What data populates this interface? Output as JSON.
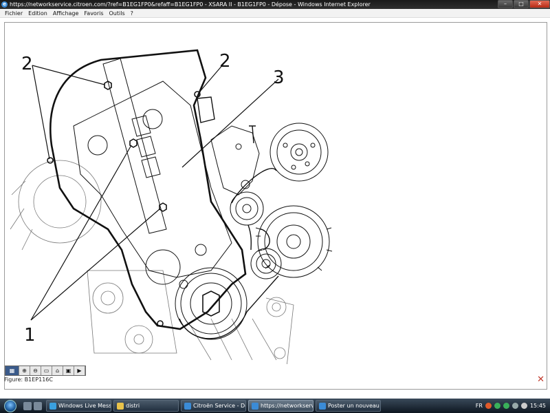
{
  "window": {
    "title": "https://networkservice.citroen.com/?ref=B1EG1FP0&refaff=B1EG1FP0 - XSARA II - B1EG1FP0 - Dépose - Windows Internet Explorer",
    "min": "–",
    "max": "□",
    "close": "✕"
  },
  "menu": [
    "Fichier",
    "Edition",
    "Affichage",
    "Favoris",
    "Outils",
    "?"
  ],
  "figure": {
    "labels": [
      "2",
      "2",
      "3",
      "1"
    ],
    "caption": "Figure: B1EP116C"
  },
  "viewer_toolbar": [
    "▦",
    "⊕",
    "⊖",
    "▭",
    "⌂",
    "▣",
    "▶"
  ],
  "close_glyph": "✕",
  "taskbar": {
    "items": [
      {
        "label": "Windows Live Mess...",
        "icon_color": "#3aa0e0"
      },
      {
        "label": "distri",
        "icon_color": "#e8c24a"
      },
      {
        "label": "Citroën Service - Do...",
        "icon_color": "#3b8bd6"
      },
      {
        "label": "https://networkservi...",
        "icon_color": "#3b8bd6"
      },
      {
        "label": "Poster un nouveau s...",
        "icon_color": "#3b8bd6"
      }
    ],
    "lang": "FR",
    "clock": "15:45"
  }
}
